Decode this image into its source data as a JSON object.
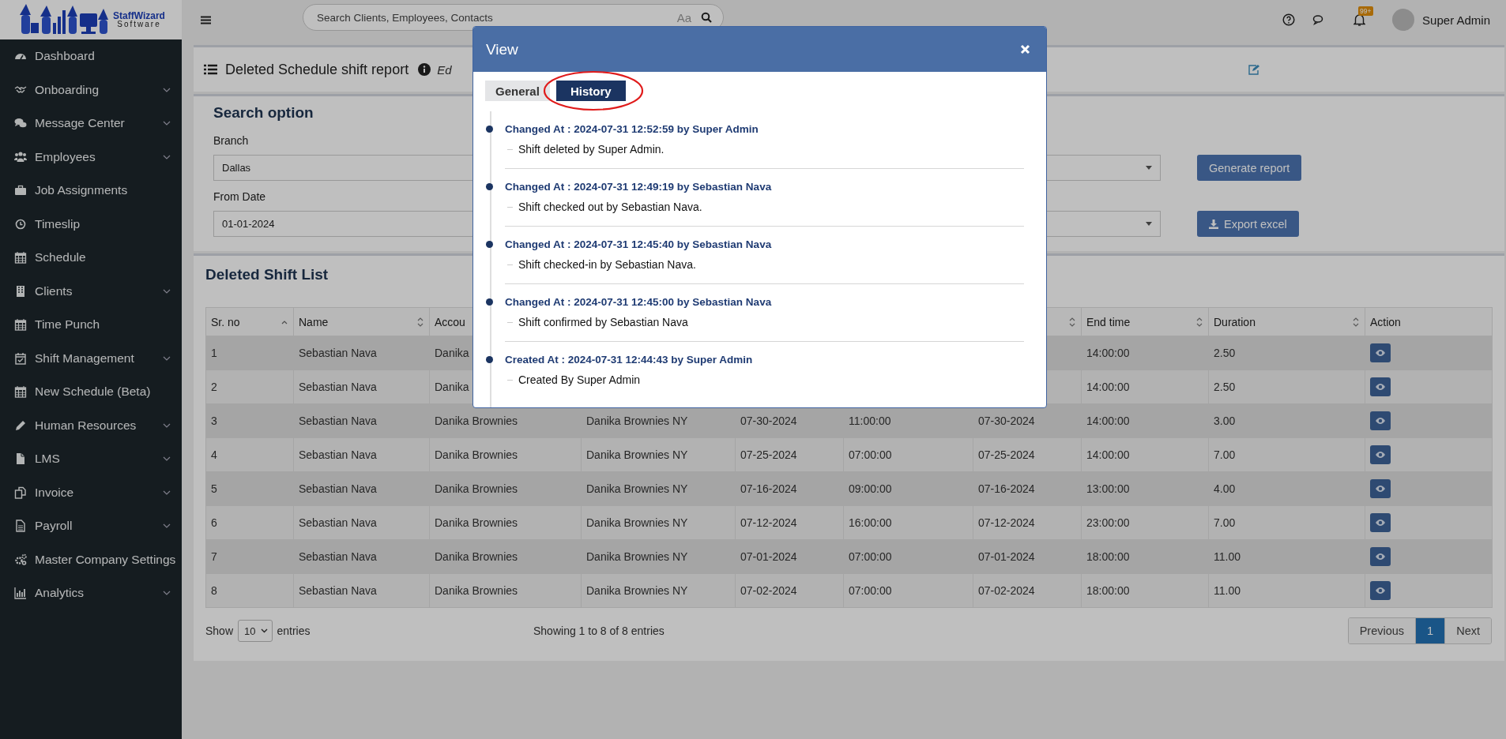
{
  "logo": {
    "name": "StaffWizard",
    "tagline": "Software"
  },
  "sidebar": {
    "items": [
      {
        "label": "Dashboard",
        "expandable": false
      },
      {
        "label": "Onboarding",
        "expandable": true
      },
      {
        "label": "Message Center",
        "expandable": true
      },
      {
        "label": "Employees",
        "expandable": true
      },
      {
        "label": "Job Assignments",
        "expandable": false
      },
      {
        "label": "Timeslip",
        "expandable": false
      },
      {
        "label": "Schedule",
        "expandable": false
      },
      {
        "label": "Clients",
        "expandable": true
      },
      {
        "label": "Time Punch",
        "expandable": false
      },
      {
        "label": "Shift Management",
        "expandable": true
      },
      {
        "label": "New Schedule (Beta)",
        "expandable": false
      },
      {
        "label": "Human Resources",
        "expandable": true
      },
      {
        "label": "LMS",
        "expandable": true
      },
      {
        "label": "Invoice",
        "expandable": true
      },
      {
        "label": "Payroll",
        "expandable": true
      },
      {
        "label": "Master Company Settings",
        "expandable": false
      },
      {
        "label": "Analytics",
        "expandable": true
      }
    ]
  },
  "topbar": {
    "search": {
      "placeholder": "Search Clients, Employees, Contacts",
      "case_toggle": "Aa"
    },
    "notifications": {
      "badge": "99+"
    },
    "user": {
      "name": "Super Admin"
    }
  },
  "page_header": {
    "title": "Deleted Schedule shift report",
    "subtitle": "Ed"
  },
  "search_option": {
    "title": "Search option",
    "fields": [
      {
        "label": "Branch",
        "value": "Dallas",
        "kind": "select"
      },
      {
        "kind": "select"
      },
      {
        "label": "From Date",
        "value": "01-01-2024",
        "kind": "input"
      },
      {
        "kind": "select"
      }
    ],
    "buttons": [
      {
        "label": "Generate report",
        "kind": "plain"
      },
      {
        "label": "Export excel",
        "kind": "export"
      }
    ]
  },
  "shift_list": {
    "title": "Deleted Shift List",
    "columns": [
      {
        "label": "Sr. no",
        "sortable": true,
        "sorted": true
      },
      {
        "label": "Name",
        "sortable": true,
        "sorted": false
      },
      {
        "label": "Accou"
      },
      {},
      {},
      {},
      {
        "sortable": true,
        "sorted": false
      },
      {
        "label": "End time",
        "sortable": true,
        "sorted": false
      },
      {
        "label": "Duration",
        "sortable": true,
        "sorted": false
      },
      {
        "label": "Action",
        "sortable": false
      }
    ],
    "rows": [
      {
        "sr_no": "1",
        "name": "Sebastian Nava",
        "account": "Danika",
        "end_time": "14:00:00",
        "duration": "2.50"
      },
      {
        "sr_no": "2",
        "name": "Sebastian Nava",
        "account": "Danika",
        "end_time": "14:00:00",
        "duration": "2.50"
      },
      {
        "sr_no": "3",
        "name": "Sebastian Nava",
        "account": "Danika Brownies",
        "column_4": "Danika Brownies NY",
        "column_5": "07-30-2024",
        "column_6": "11:00:00",
        "column_7": "07-30-2024",
        "end_time": "14:00:00",
        "duration": "3.00"
      },
      {
        "sr_no": "4",
        "name": "Sebastian Nava",
        "account": "Danika Brownies",
        "column_4": "Danika Brownies NY",
        "column_5": "07-25-2024",
        "column_6": "07:00:00",
        "column_7": "07-25-2024",
        "end_time": "14:00:00",
        "duration": "7.00"
      },
      {
        "sr_no": "5",
        "name": "Sebastian Nava",
        "account": "Danika Brownies",
        "column_4": "Danika Brownies NY",
        "column_5": "07-16-2024",
        "column_6": "09:00:00",
        "column_7": "07-16-2024",
        "end_time": "13:00:00",
        "duration": "4.00"
      },
      {
        "sr_no": "6",
        "name": "Sebastian Nava",
        "account": "Danika Brownies",
        "column_4": "Danika Brownies NY",
        "column_5": "07-12-2024",
        "column_6": "16:00:00",
        "column_7": "07-12-2024",
        "end_time": "23:00:00",
        "duration": "7.00"
      },
      {
        "sr_no": "7",
        "name": "Sebastian Nava",
        "account": "Danika Brownies",
        "column_4": "Danika Brownies NY",
        "column_5": "07-01-2024",
        "column_6": "07:00:00",
        "column_7": "07-01-2024",
        "end_time": "18:00:00",
        "duration": "11.00"
      },
      {
        "sr_no": "8",
        "name": "Sebastian Nava",
        "account": "Danika Brownies",
        "column_4": "Danika Brownies NY",
        "column_5": "07-02-2024",
        "column_6": "07:00:00",
        "column_7": "07-02-2024",
        "end_time": "18:00:00",
        "duration": "11.00"
      }
    ],
    "entries": {
      "show_label": "Show",
      "page_size": "10",
      "suffix": "entries",
      "info": "Showing 1 to 8 of 8 entries"
    },
    "pagination": [
      {
        "label": "Previous",
        "selected": false
      },
      {
        "label": "1",
        "selected": true
      },
      {
        "label": "Next",
        "selected": false
      }
    ]
  },
  "modal": {
    "title": "View",
    "tabs": [
      {
        "label": "General",
        "selected": false,
        "circled": false
      },
      {
        "label": "History",
        "selected": true,
        "circled": true
      }
    ],
    "history": [
      {
        "heading": "Changed At : 2024-07-31 12:52:59 by Super Admin",
        "note": "Shift deleted by Super Admin."
      },
      {
        "heading": "Changed At : 2024-07-31 12:49:19 by Sebastian Nava",
        "note": "Shift checked out by Sebastian Nava."
      },
      {
        "heading": "Changed At : 2024-07-31 12:45:40 by Sebastian Nava",
        "note": "Shift checked-in by Sebastian Nava."
      },
      {
        "heading": "Changed At : 2024-07-31 12:45:00 by Sebastian Nava",
        "note": "Shift confirmed by Sebastian Nava"
      },
      {
        "heading": "Created At : 2024-07-31 12:44:43 by Super Admin",
        "note": "Created By Super Admin"
      }
    ]
  }
}
